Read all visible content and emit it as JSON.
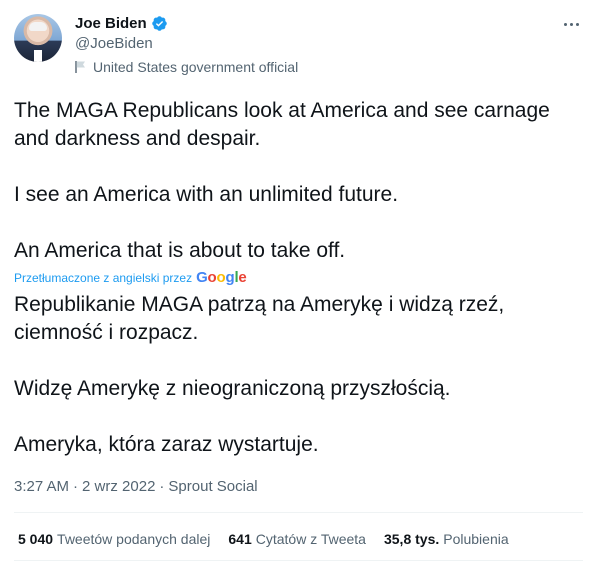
{
  "author": {
    "name": "Joe Biden",
    "handle": "@JoeBiden",
    "label": "United States government official"
  },
  "tweet": {
    "original": [
      "The MAGA Republicans look at America and see carnage and darkness and despair.",
      "I see an America with an unlimited future.",
      "An America that is about to take off."
    ],
    "translated_by": "Przetłumaczone z angielski przez",
    "translator": "Google",
    "translation": [
      "Republikanie MAGA patrzą na Amerykę i widzą rzeź, ciemność i rozpacz.",
      "Widzę Amerykę z nieograniczoną przyszłością.",
      "Ameryka, która zaraz wystartuje."
    ]
  },
  "meta": {
    "time": "3:27 AM",
    "date": "2 wrz 2022",
    "source": "Sprout Social",
    "separator": "·"
  },
  "stats": [
    {
      "count": "5 040",
      "label": "Tweetów podanych dalej"
    },
    {
      "count": "641",
      "label": "Cytatów z Tweeta"
    },
    {
      "count": "35,8 tys.",
      "label": "Polubienia"
    }
  ],
  "colors": {
    "accent": "#1d9bf0",
    "text": "#0f1419",
    "secondary": "#536471",
    "divider": "#eff3f4"
  },
  "icons": [
    "verified-badge-icon",
    "flag-icon",
    "more-icon"
  ]
}
